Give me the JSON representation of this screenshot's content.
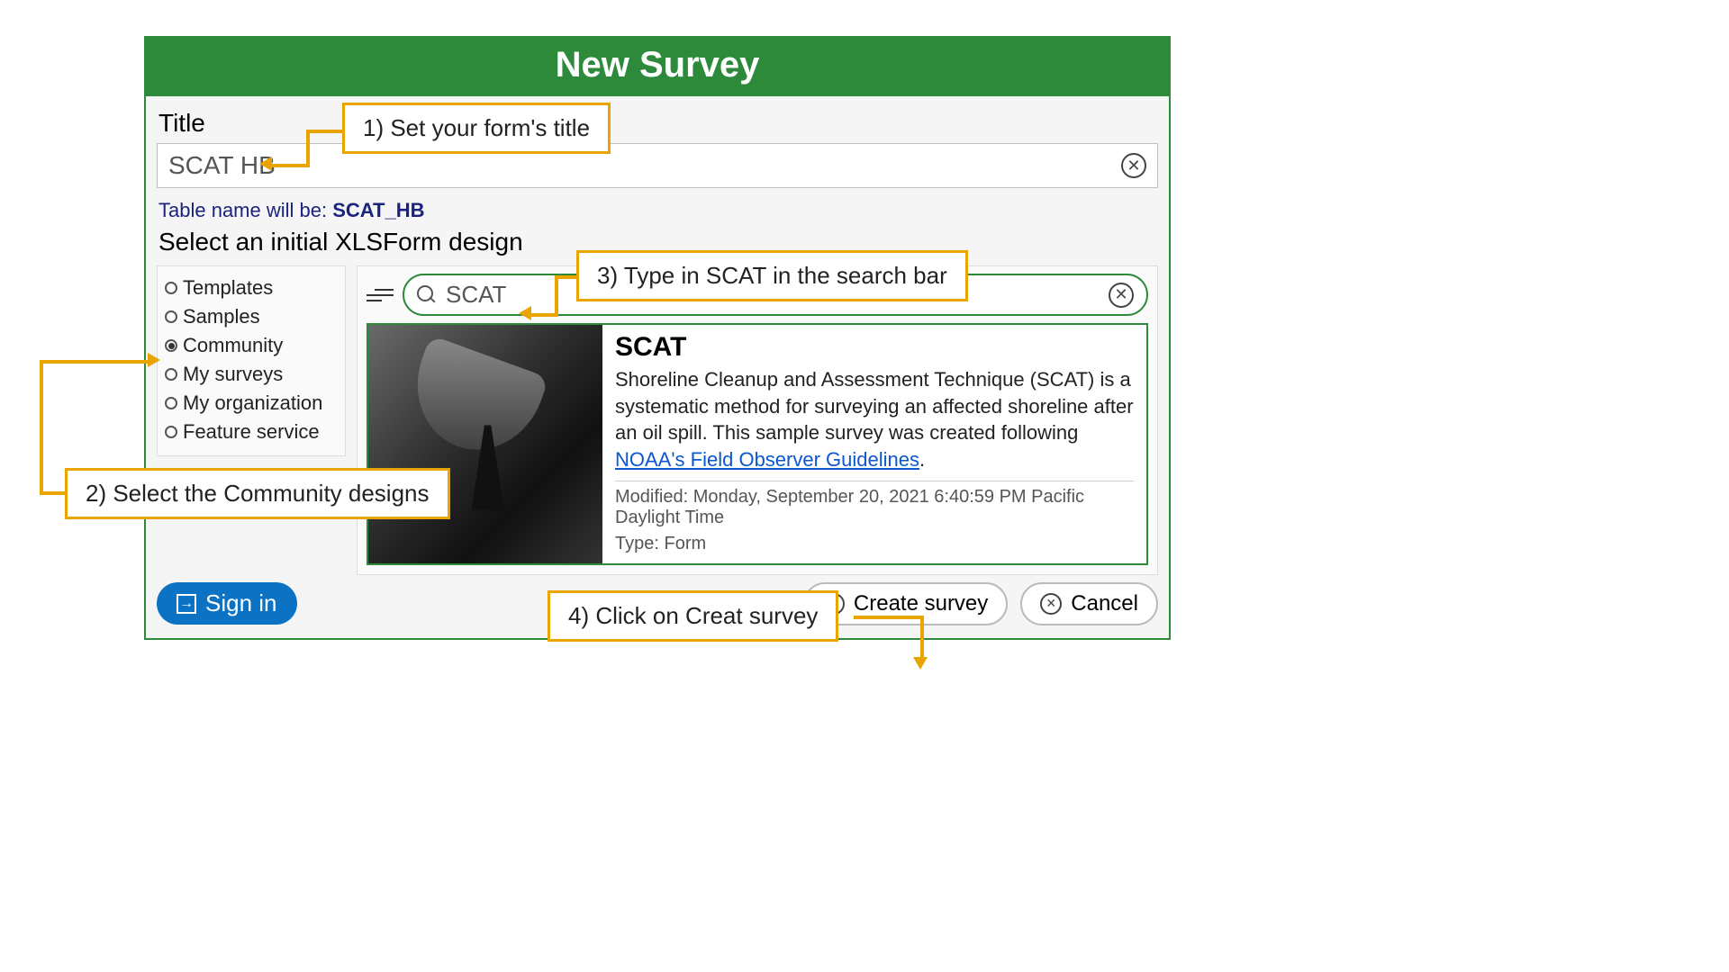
{
  "header": {
    "title": "New Survey"
  },
  "title_section": {
    "label": "Title",
    "value": "SCAT HB",
    "table_prefix": "Table name will be: ",
    "table_value": "SCAT_HB"
  },
  "select_header": "Select an initial XLSForm design",
  "sources": [
    {
      "label": "Templates",
      "selected": false
    },
    {
      "label": "Samples",
      "selected": false
    },
    {
      "label": "Community",
      "selected": true
    },
    {
      "label": "My surveys",
      "selected": false
    },
    {
      "label": "My organization",
      "selected": false
    },
    {
      "label": "Feature service",
      "selected": false
    }
  ],
  "search": {
    "value": "SCAT"
  },
  "result": {
    "title": "SCAT",
    "desc_before_link": "Shoreline Cleanup and Assessment Technique (SCAT) is a systematic method for surveying an affected shoreline after an oil spill. This sample survey was created following ",
    "link_text": "NOAA's Field Observer Guidelines",
    "desc_after_link": ".",
    "modified_label": "Modified: ",
    "modified_value": "Monday, September 20, 2021 6:40:59 PM Pacific Daylight Time",
    "type_label": "Type: ",
    "type_value": "Form"
  },
  "footer": {
    "signin": "Sign in",
    "create": "Create survey",
    "cancel": "Cancel"
  },
  "annotations": {
    "step1": "1) Set your form's title",
    "step2": "2) Select the Community designs",
    "step3": "3) Type in SCAT in the search bar",
    "step4": "4) Click on Creat survey"
  }
}
